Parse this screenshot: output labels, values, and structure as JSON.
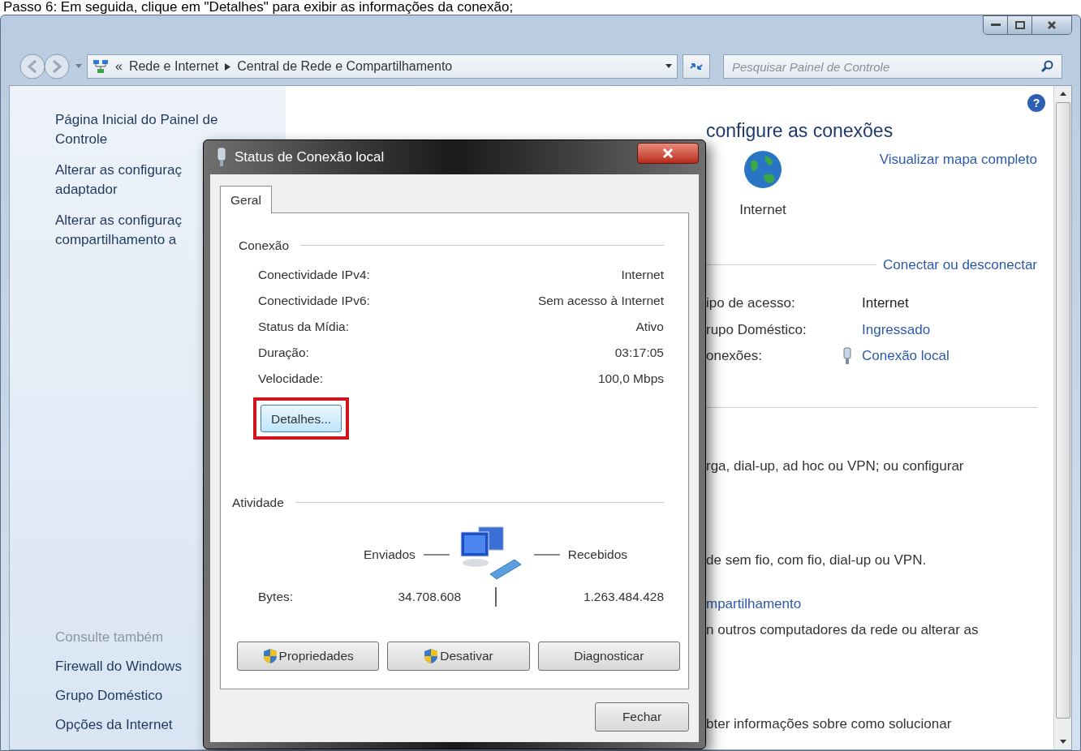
{
  "caption": "Passo 6: Em seguida, clique em \"Detalhes\" para exibir as informações da conexão;",
  "address_bar": {
    "overflow_marker": "«",
    "breadcrumbs": [
      "Rede e Internet",
      "Central de Rede e Compartilhamento"
    ]
  },
  "search": {
    "placeholder": "Pesquisar Painel de Controle"
  },
  "sidebar": {
    "items": [
      {
        "lines": [
          "Página Inicial do Painel de",
          "Controle"
        ]
      },
      {
        "lines": [
          "Alterar as configuraç",
          "adaptador"
        ]
      },
      {
        "lines": [
          "Alterar as configuraç",
          "compartilhamento a"
        ]
      }
    ],
    "see_also": {
      "title": "Consulte também",
      "items": [
        "Firewall do Windows",
        "Grupo Doméstico",
        "Opções da Internet"
      ]
    }
  },
  "main": {
    "help_glyph": "?",
    "heading": "configure as conexões",
    "map_link": "Visualizar mapa completo",
    "internet_label": "Internet",
    "connect_link": "Conectar ou desconectar",
    "properties": [
      {
        "label": "ipo de acesso:",
        "value": "Internet",
        "kind": "text"
      },
      {
        "label": "rupo Doméstico:",
        "value": "Ingressado",
        "kind": "link"
      },
      {
        "label": "onexões:",
        "value": "Conexão local",
        "kind": "connection"
      }
    ],
    "fragments": [
      {
        "text": "rga, dial-up, ad hoc ou VPN; ou configurar",
        "kind": "text"
      },
      {
        "text": "de sem fio, com fio, dial-up ou VPN.",
        "kind": "text"
      },
      {
        "text": "mpartilhamento",
        "kind": "link"
      },
      {
        "text": "n outros computadores da rede ou alterar as",
        "kind": "text"
      },
      {
        "text": "bter informações sobre como solucionar",
        "kind": "text"
      }
    ]
  },
  "dialog": {
    "title": "Status de Conexão local",
    "tabs": [
      {
        "label": "Geral",
        "selected": true
      }
    ],
    "connection": {
      "title": "Conexão",
      "rows": [
        {
          "label": "Conectividade IPv4:",
          "value": "Internet"
        },
        {
          "label": "Conectividade IPv6:",
          "value": "Sem acesso à Internet"
        },
        {
          "label": "Status da Mídia:",
          "value": "Ativo"
        },
        {
          "label": "Duração:",
          "value": "03:17:05"
        },
        {
          "label": "Velocidade:",
          "value": "100,0 Mbps"
        }
      ]
    },
    "details_button": {
      "label": "Detalhes...",
      "highlighted": true
    },
    "activity": {
      "title": "Atividade",
      "sent_label": "Enviados",
      "received_label": "Recebidos",
      "bytes_label": "Bytes:",
      "sent": "34.708.608",
      "received": "1.263.484.428"
    },
    "buttons": [
      {
        "label": "Propriedades",
        "kind": "shield"
      },
      {
        "label": "Desativar",
        "kind": "shield"
      },
      {
        "label": "Diagnosticar",
        "kind": "plain"
      }
    ],
    "close_button": "Fechar"
  }
}
